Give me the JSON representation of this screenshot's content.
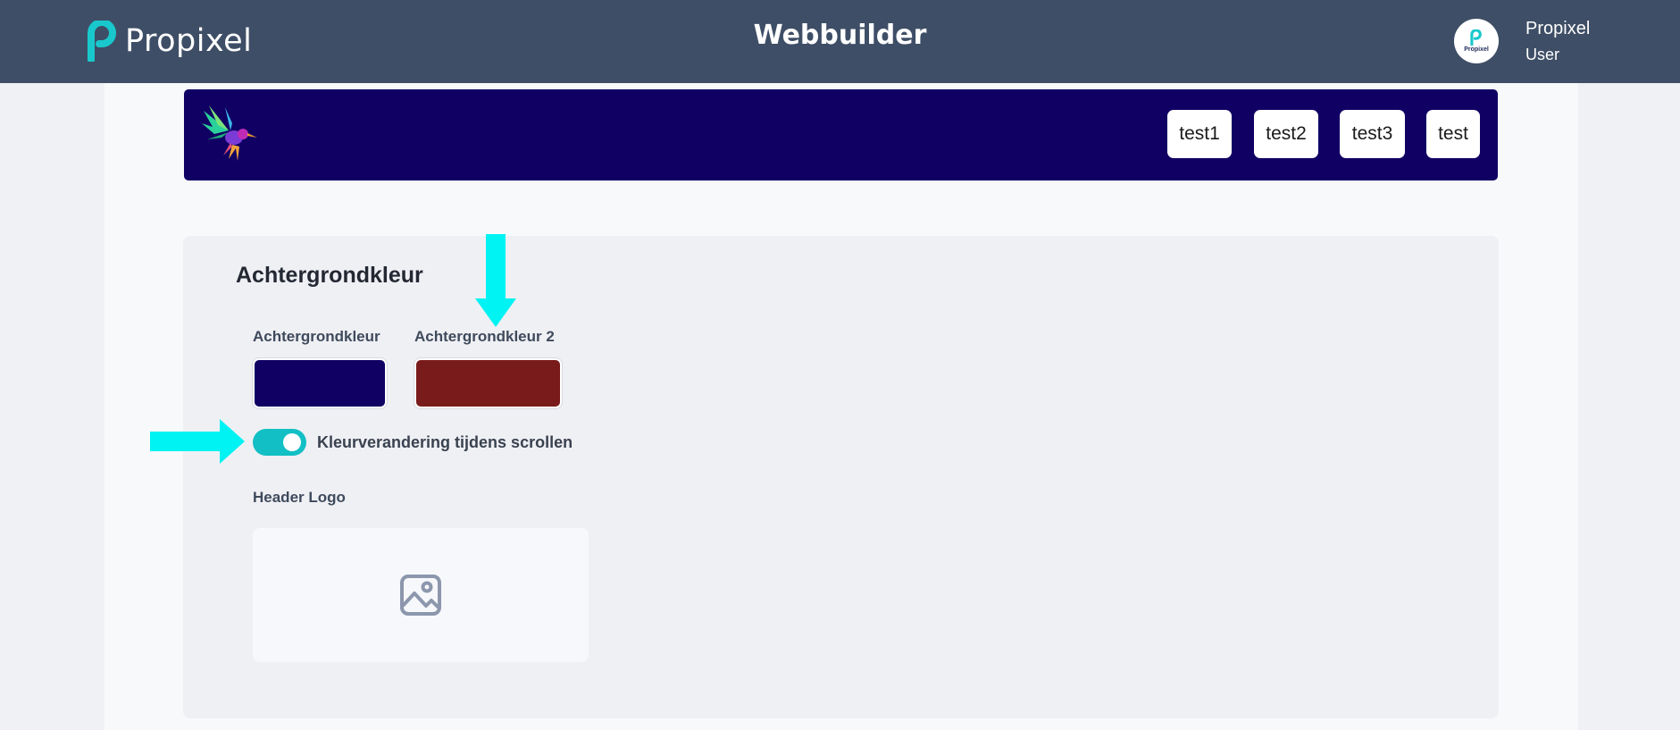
{
  "topbar": {
    "brand_name": "Propixel",
    "app_title": "Webbuilder",
    "user": {
      "avatar_text": "Propixel",
      "name": "Propixel",
      "role": "User"
    }
  },
  "preview": {
    "background_color": "#100064",
    "logo_icon": "hummingbird-icon",
    "nav_items": [
      {
        "label": "test1"
      },
      {
        "label": "test2"
      },
      {
        "label": "test3"
      },
      {
        "label": "test"
      }
    ]
  },
  "panel": {
    "title": "Achtergrondkleur",
    "color_fields": [
      {
        "label": "Achtergrondkleur",
        "value": "#100064"
      },
      {
        "label": "Achtergrondkleur 2",
        "value": "#7a1b1b"
      }
    ],
    "scroll_toggle": {
      "label": "Kleurverandering tijdens scrollen",
      "checked": true
    },
    "logo_field": {
      "label": "Header Logo",
      "icon": "image-icon"
    }
  },
  "annotations": {
    "arrow_color": "#00f3f3",
    "arrows": [
      "arrow-down",
      "arrow-right"
    ]
  },
  "colors": {
    "topbar": "#3e4e66",
    "accent": "#12bfc4"
  }
}
